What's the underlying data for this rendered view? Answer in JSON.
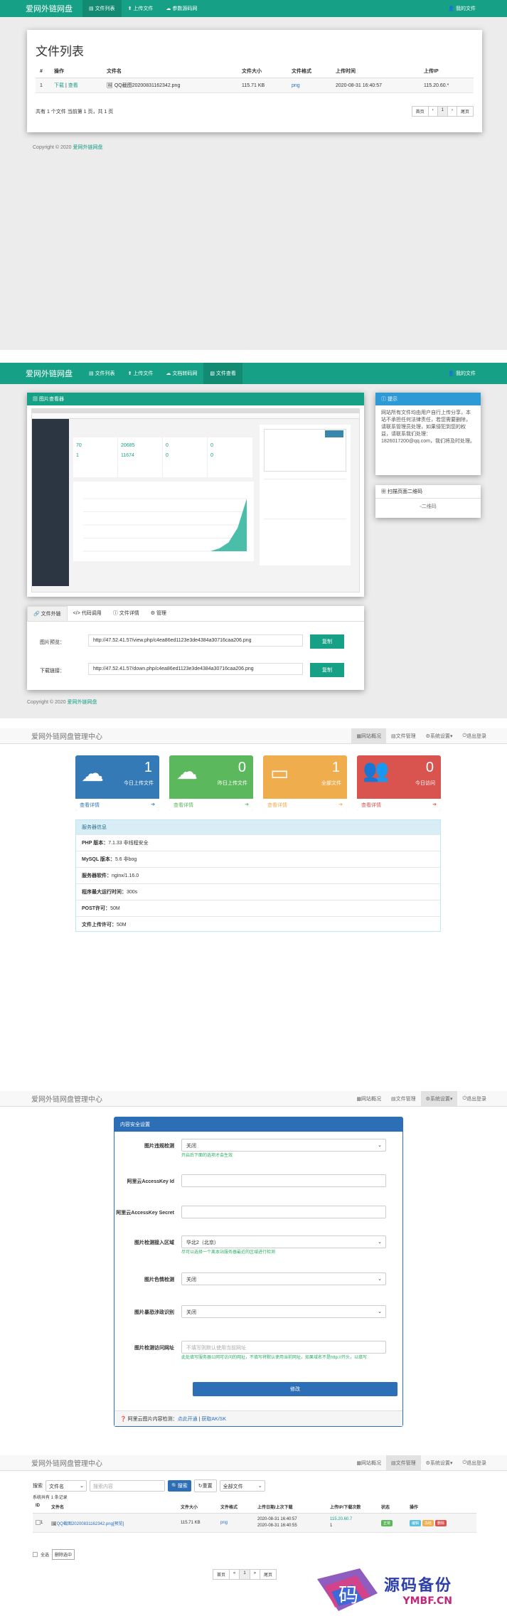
{
  "s1": {
    "brand": "爱网外链网盘",
    "nav": [
      "文件列表",
      "上传文件",
      "参数源码网"
    ],
    "right": "我的文件",
    "title": "文件列表",
    "headers": [
      "#",
      "操作",
      "文件名",
      "文件大小",
      "文件格式",
      "上传时间",
      "上传IP"
    ],
    "row": {
      "num": "1",
      "download": "下载",
      "sep": " | ",
      "view": "查看",
      "name": "QQ截图20200831162342.png",
      "size": "115.71 KB",
      "type": "png",
      "time": "2020-08-31 16:40:57",
      "ip": "115.20.60.*"
    },
    "summary": "共有 1 个文件  当前第 1 页，共 1 页",
    "pager": [
      "首页",
      "‹",
      "1",
      "›",
      "尾页"
    ],
    "copyright": "Copyright © 2020",
    "copyright_link": "爱网外链网盘"
  },
  "s2": {
    "brand": "爱网外链网盘",
    "nav": [
      "文件列表",
      "上传文件",
      "文档转码网",
      "文件查看"
    ],
    "right": "我的文件",
    "preview_title": "图片查看器",
    "tip_title": "提示",
    "tip_text": "网站所有文件均由用户自行上传分享，本站不承担任何法律责任，若您需要删除，请联系管理员处理，如果侵犯到您的权益，请联系我们处理：1826017200@qq.com，我们将及时处理。",
    "qr_title": "扫描页面二维码",
    "qr_img": "二维码",
    "tabs": [
      "文件外链",
      "代码调用",
      "文件详情",
      "管理"
    ],
    "img_label": "图片预览：",
    "img_url": "http://47.52.41.57/view.php/c4ea86ed1123e3de4384a30716caa206.png",
    "img_btn": "复制",
    "dl_label": "下载链接：",
    "dl_url": "http://47.52.41.57/down.php/c4ea86ed1123e3de4384a30716caa206.png",
    "dl_btn": "复制",
    "copyright": "Copyright © 2020",
    "copyright_link": "爱网外链网盘",
    "mini": {
      "stats": [
        "70",
        "20685",
        "0",
        "0",
        "1",
        "11674",
        "0",
        "0"
      ],
      "chart_values": [
        0,
        0,
        0,
        0,
        0,
        0,
        0,
        0,
        0,
        0,
        0,
        0,
        0,
        0,
        0,
        1,
        3,
        8,
        18
      ]
    }
  },
  "s3": {
    "brand": "爱网外链网盘管理中心",
    "nav": [
      "网站概况",
      "文件管理",
      "系统设置",
      "退出登录"
    ],
    "cards": [
      {
        "num": "1",
        "label": "今日上传文件",
        "link": "查看详情",
        "color": "#337ab7"
      },
      {
        "num": "0",
        "label": "昨日上传文件",
        "link": "查看详情",
        "color": "#5cb85c"
      },
      {
        "num": "1",
        "label": "全部文件",
        "link": "查看详情",
        "color": "#f0ad4e"
      },
      {
        "num": "0",
        "label": "今日访问",
        "link": "查看详情",
        "color": "#d9534f"
      }
    ],
    "info_title": "服务器信息",
    "info": [
      {
        "k": "PHP 版本：",
        "v": "7.1.33 非线程安全"
      },
      {
        "k": "MySQL 版本：",
        "v": "5.6 非bog"
      },
      {
        "k": "服务器软件：",
        "v": "nginx/1.16.0"
      },
      {
        "k": "程序最大运行时间：",
        "v": "300s"
      },
      {
        "k": "POST许可：",
        "v": "50M"
      },
      {
        "k": "文件上传许可：",
        "v": "50M"
      }
    ]
  },
  "s4": {
    "brand": "爱网外链网盘管理中心",
    "nav": [
      "网站概况",
      "文件管理",
      "系统设置",
      "退出登录"
    ],
    "panel_title": "内容安全设置",
    "rows": [
      {
        "label": "图片违规检测",
        "value": "关闭",
        "hint": "开启后下面的选项才会生效",
        "select": true
      },
      {
        "label": "阿里云AccessKey Id",
        "value": "",
        "hint": "",
        "select": false
      },
      {
        "label": "阿里云AccessKey Secret",
        "value": "",
        "hint": "",
        "select": false
      },
      {
        "label": "图片检测接入区域",
        "value": "华北2（北京）",
        "hint": "尽可以选择一个离本站服务器最近的区域进行检测",
        "select": true
      },
      {
        "label": "图片色情检测",
        "value": "关闭",
        "hint": "",
        "select": true
      },
      {
        "label": "图片暴恐涉政识别",
        "value": "关闭",
        "hint": "",
        "select": true
      },
      {
        "label": "图片检测访问网址",
        "value": "",
        "placeholder": "不填写则默认使用当前网址",
        "hint": "此处填写服务器公网可访问的网址，不填写将默认使用当前网址，如果域名不是http://开头，以填写",
        "select": false
      }
    ],
    "submit": "修改",
    "footer_text": "阿里云图片内容检测：",
    "footer_link1": "点此开通",
    "footer_link2": "获取AK/SK"
  },
  "s5": {
    "brand": "爱网外链网盘管理中心",
    "nav": [
      "网站概况",
      "文件管理",
      "系统设置",
      "退出登录"
    ],
    "search_label": "搜索",
    "search_type": "文件名",
    "search_placeholder": "搜索内容",
    "search_btn": "搜索",
    "reset_btn": "重置",
    "filter": "全部文件",
    "count": "系统共有 1 条记录",
    "headers": [
      "ID",
      "文件名",
      "文件大小",
      "文件格式",
      "上传日期/上次下载",
      "上传IP/下载次数",
      "状态",
      "操作"
    ],
    "row": {
      "id": "1",
      "name": "QQ截图20200831162342.png",
      "preview": "[预览]",
      "size": "115.71 KB",
      "type": "png",
      "date1": "2020-08-31 16:40:57",
      "date2": "2020-08-31 16:40:55",
      "ip": "115.20.60.7",
      "count": "1",
      "status": "正常",
      "ops": [
        "编辑",
        "冻结",
        "删除"
      ]
    },
    "select_all": "全选",
    "batch_btn": "删除选中",
    "pager": [
      "首页",
      "«",
      "1",
      "»",
      "尾页"
    ]
  },
  "watermark": {
    "char": "码",
    "text": "源码备份",
    "url": "YMBF.CN"
  }
}
